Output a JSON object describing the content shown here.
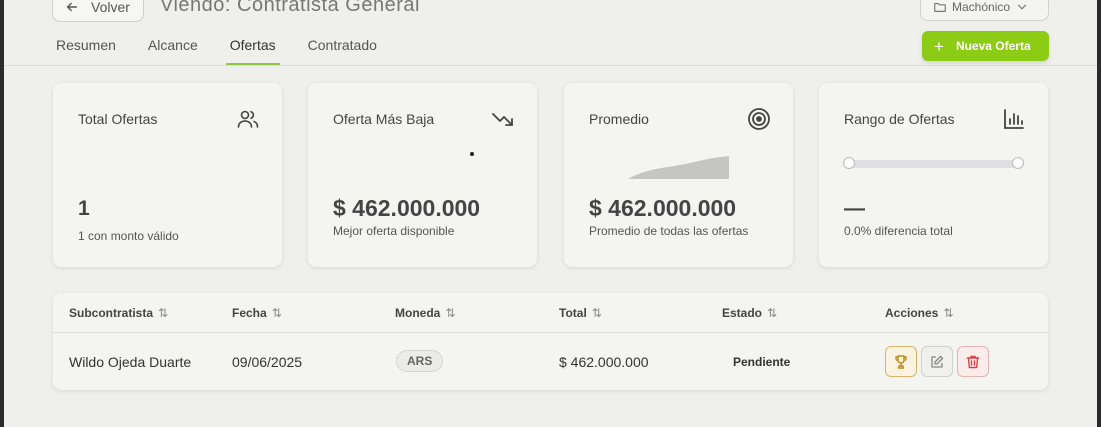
{
  "header": {
    "back_label": "Volver",
    "title": "Viendo: Contratista General",
    "project": "Machónico",
    "new_offer_label": "Nueva Oferta",
    "accent": "#8ccc14"
  },
  "tabs": [
    {
      "label": "Resumen",
      "active": false
    },
    {
      "label": "Alcance",
      "active": false
    },
    {
      "label": "Ofertas",
      "active": true
    },
    {
      "label": "Contratado",
      "active": false
    }
  ],
  "cards": {
    "total": {
      "title": "Total Ofertas",
      "value": "1",
      "sub": "1 con monto válido",
      "icon": "users-icon"
    },
    "lowest": {
      "title": "Oferta Más Baja",
      "value": "$ 462.000.000",
      "sub": "Mejor oferta disponible",
      "icon": "trending-down-icon"
    },
    "average": {
      "title": "Promedio",
      "value": "$ 462.000.000",
      "sub": "Promedio de todas las ofertas",
      "icon": "target-icon"
    },
    "range": {
      "title": "Rango de Ofertas",
      "value": "—",
      "sub": "0.0% diferencia total",
      "icon": "bar-chart-icon",
      "min_fraction": 0,
      "max_fraction": 1
    }
  },
  "table": {
    "columns": [
      "Subcontratista",
      "Fecha",
      "Moneda",
      "Total",
      "Estado",
      "Acciones"
    ],
    "rows": [
      {
        "subcontractor": "Wildo Ojeda Duarte",
        "date": "09/06/2025",
        "currency": "ARS",
        "total": "$ 462.000.000",
        "status": "Pendiente"
      }
    ]
  }
}
